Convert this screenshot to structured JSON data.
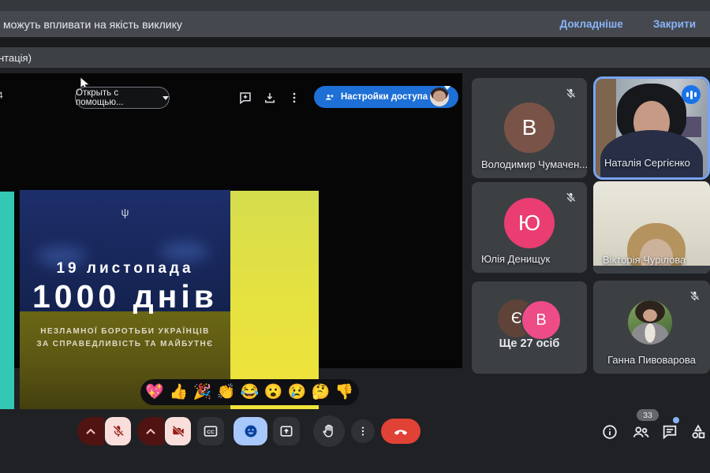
{
  "banner": {
    "message": "можуть впливати на якість виклику",
    "details_label": "Докладніше",
    "close_label": "Закрити"
  },
  "doc_bar": {
    "title_fragment": "нтація)"
  },
  "preview_toolbar": {
    "page_fragment": "4",
    "open_with_label": "Открыть с помощью...",
    "share_settings_label": "Настройки доступа"
  },
  "slide": {
    "emblem": "ψ",
    "date": "19 листопада",
    "headline": "1000 днів",
    "subline1": "НЕЗЛАМНОЇ БОРОТЬБИ УКРАЇНЦІВ",
    "subline2": "ЗА СПРАВЕДЛИВІСТЬ  ТА МАЙБУТНЄ"
  },
  "participants": [
    {
      "name": "Володимир Чумачен...",
      "initial": "В"
    },
    {
      "name": "Наталія Сергієнко"
    },
    {
      "name": "Юлія Денищук",
      "initial": "Ю"
    },
    {
      "name": "Вікторія Чурілова"
    },
    {
      "name": "Ще 27 осіб",
      "initials": [
        "Є",
        "В"
      ]
    },
    {
      "name": "Ганна Пивоварова"
    }
  ],
  "reactions": [
    "💖",
    "👍",
    "🎉",
    "👏",
    "😂",
    "😮",
    "😢",
    "🤔",
    "👎"
  ],
  "footer": {
    "participants_count": "33"
  },
  "colors": {
    "link_blue": "#8ab4f8",
    "share_button_blue": "#1e6fd6",
    "active_speaker_border": "#77a4f5",
    "speaking_indicator": "#1a73e8",
    "end_call_red": "#e04235",
    "muted_button_pink": "#f9dedc",
    "muted_chevron_maroon": "#4f1412",
    "reactions_active_blue": "#a8c7fa",
    "avatar_brown": "#7a5348",
    "avatar_pink": "#ea3d72",
    "slide_teal": "#32c8b4",
    "slide_yellow": "#f0e43a"
  }
}
